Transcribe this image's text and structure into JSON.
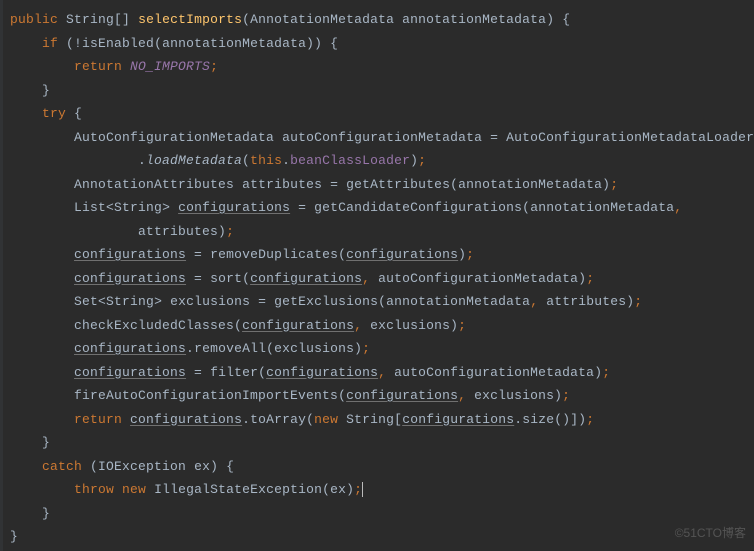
{
  "code": {
    "kw_public": "public",
    "type_string_arr": "String[]",
    "method_name": "selectImports",
    "param_type1": "AnnotationMetadata",
    "param_name1": "annotationMetadata",
    "kw_if": "if",
    "call_isEnabled": "isEnabled",
    "kw_return": "return",
    "NO_IMPORTS": "NO_IMPORTS",
    "kw_try": "try",
    "type_acm": "AutoConfigurationMetadata",
    "var_acm": "autoConfigurationMetadata",
    "type_acml": "AutoConfigurationMetadataLoader",
    "call_loadMetadata": "loadMetadata",
    "kw_this": "this",
    "field_bcl": "beanClassLoader",
    "type_aa": "AnnotationAttributes",
    "var_attributes": "attributes",
    "call_getAttributes": "getAttributes",
    "type_list": "List",
    "type_string": "String",
    "var_configurations": "configurations",
    "call_getCandidate": "getCandidateConfigurations",
    "call_removeDup": "removeDuplicates",
    "call_sort": "sort",
    "type_set": "Set",
    "var_exclusions": "exclusions",
    "call_getExclusions": "getExclusions",
    "call_checkExcluded": "checkExcludedClasses",
    "call_removeAll": "removeAll",
    "call_filter": "filter",
    "call_fireEvents": "fireAutoConfigurationImportEvents",
    "call_toArray": "toArray",
    "kw_new": "new",
    "call_size": "size",
    "kw_catch": "catch",
    "type_ioe": "IOException",
    "var_ex": "ex",
    "kw_throw": "throw",
    "type_ise": "IllegalStateException"
  },
  "watermark": "©51CTO博客"
}
